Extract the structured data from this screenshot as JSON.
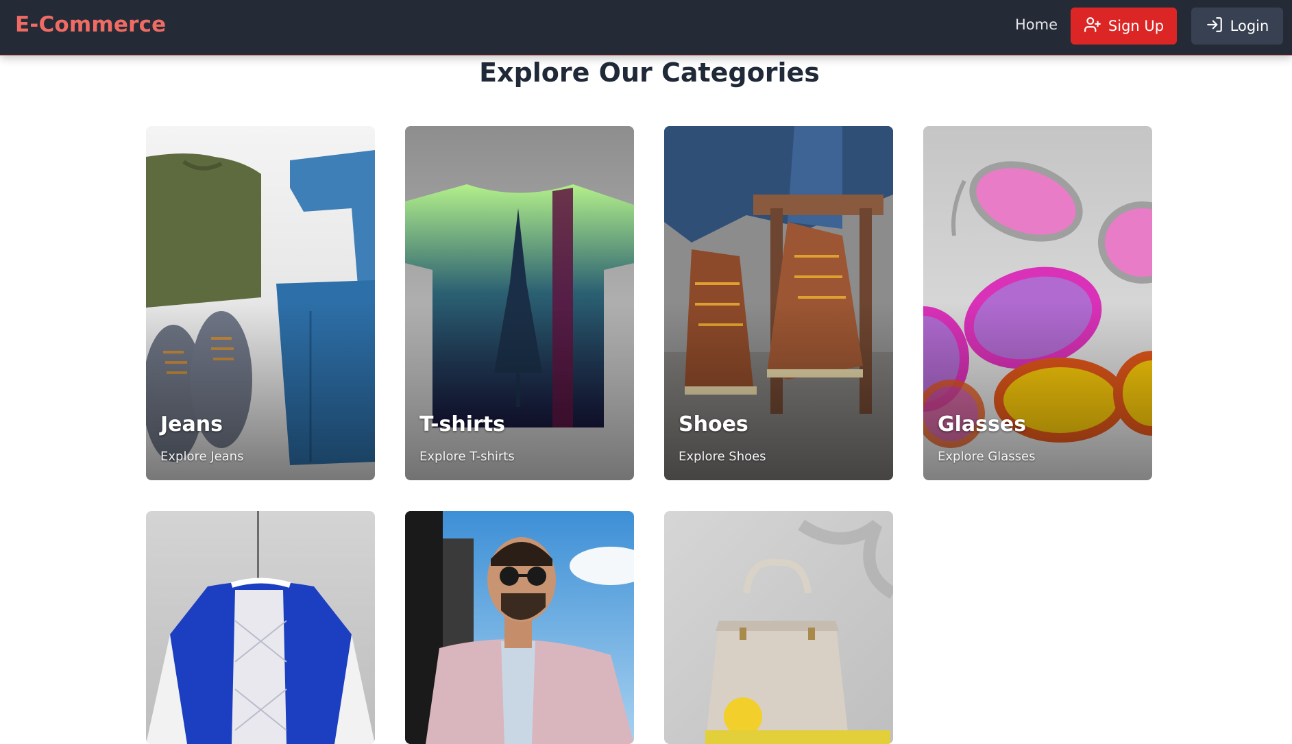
{
  "nav": {
    "brand": "E-Commerce",
    "home": "Home",
    "signup": "Sign Up",
    "login": "Login"
  },
  "page": {
    "heading": "Explore Our Categories"
  },
  "categories": [
    {
      "title": "Jeans",
      "subtitle": "Explore Jeans"
    },
    {
      "title": "T-shirts",
      "subtitle": "Explore T-shirts"
    },
    {
      "title": "Shoes",
      "subtitle": "Explore Shoes"
    },
    {
      "title": "Glasses",
      "subtitle": "Explore Glasses"
    },
    {
      "title": "",
      "subtitle": ""
    },
    {
      "title": "",
      "subtitle": ""
    },
    {
      "title": "",
      "subtitle": ""
    }
  ],
  "colors": {
    "nav_bg": "#242b37",
    "brand": "#f06b63",
    "signup_bg": "#dc2626",
    "login_bg": "#374151"
  }
}
